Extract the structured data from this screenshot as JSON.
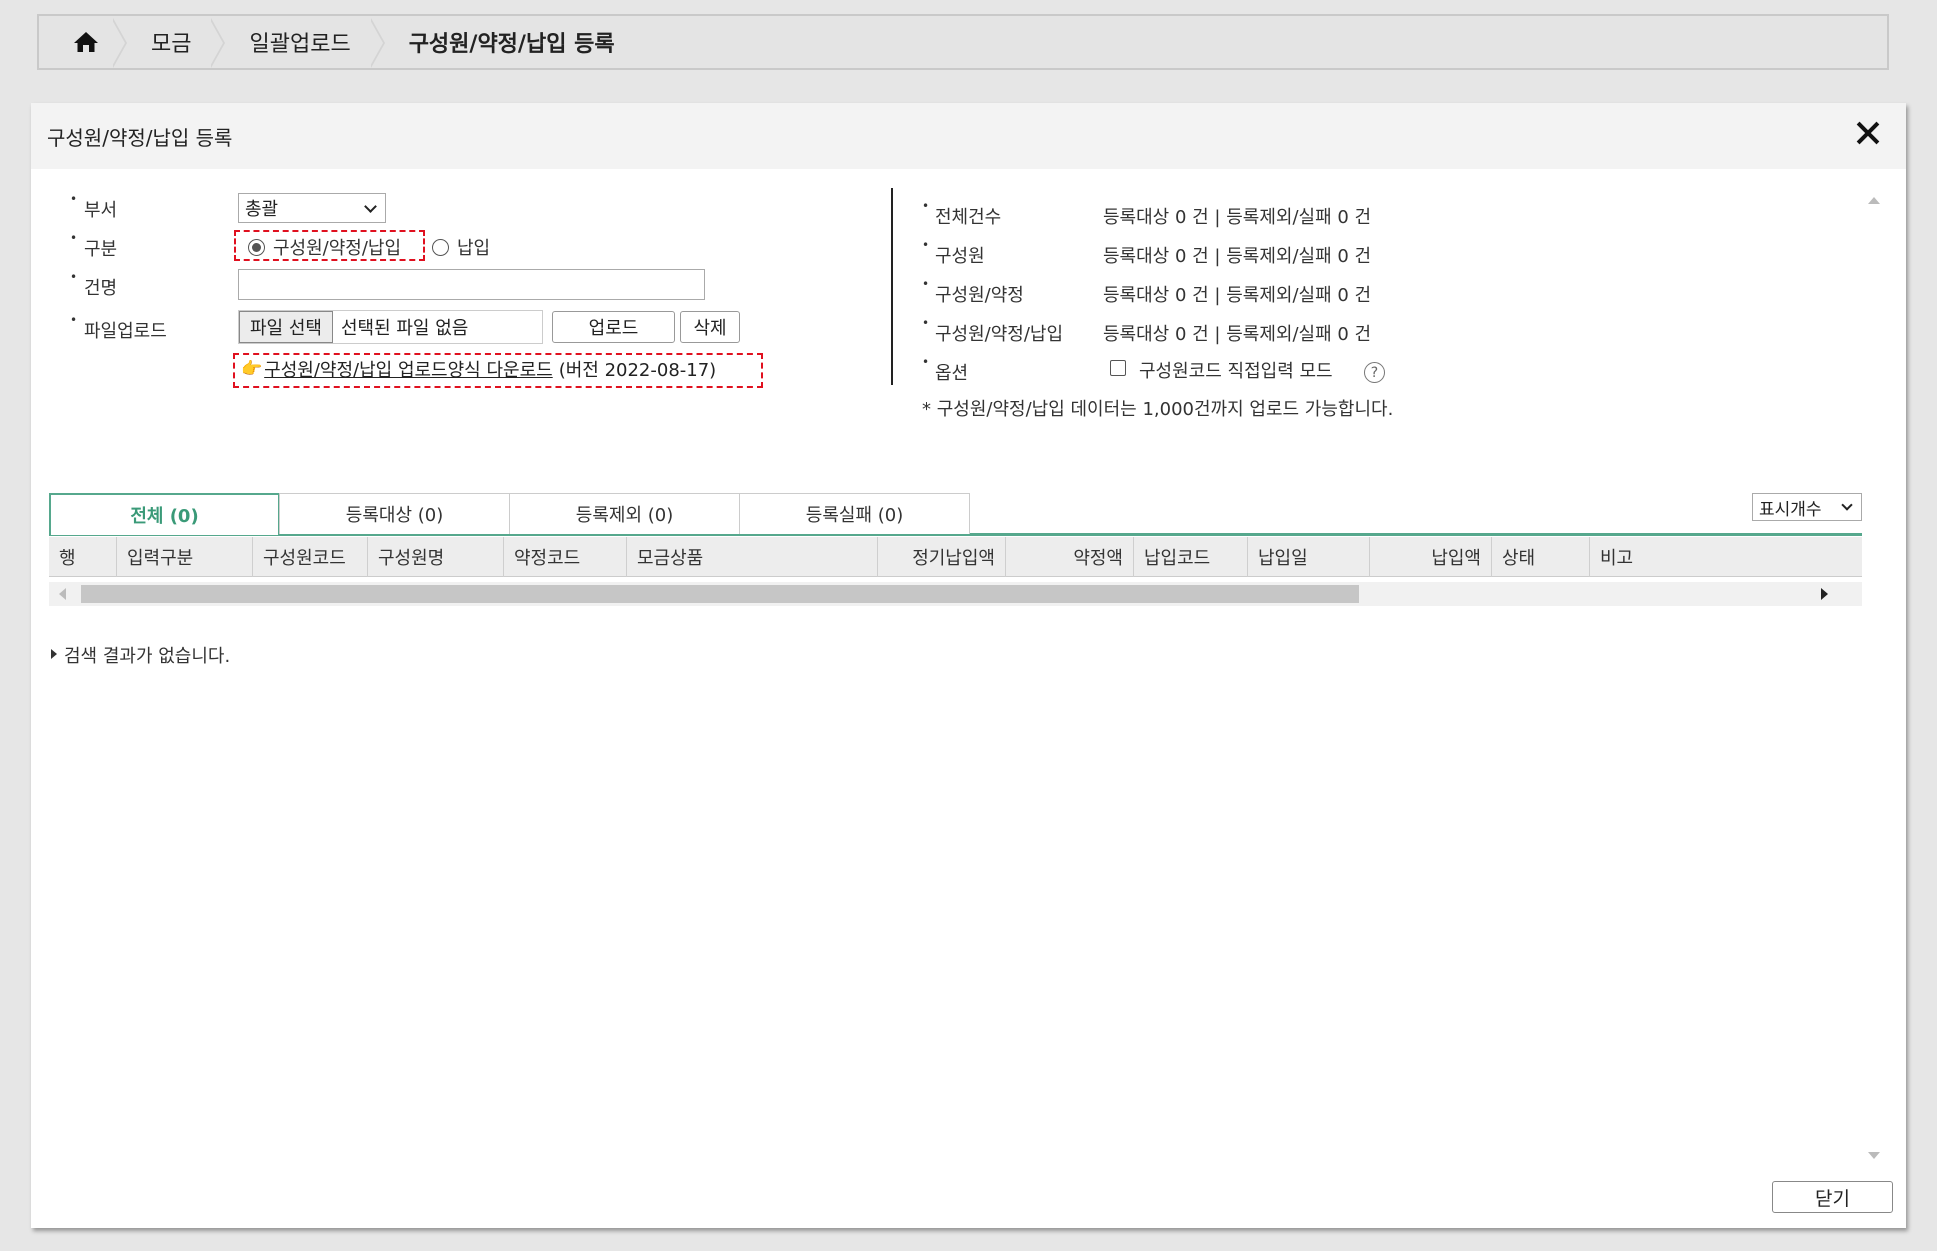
{
  "breadcrumb": {
    "items": [
      "모금",
      "일괄업로드"
    ],
    "current": "구성원/약정/납입 등록"
  },
  "dialog": {
    "title": "구성원/약정/납입 등록",
    "form": {
      "dept_label": "부서",
      "dept_value": "총괄",
      "type_label": "구분",
      "type_options": [
        "구성원/약정/납입",
        "납입"
      ],
      "type_selected": "구성원/약정/납입",
      "name_label": "건명",
      "name_value": "",
      "file_label": "파일업로드",
      "file_button": "파일 선택",
      "file_status": "선택된 파일 없음",
      "upload_button": "업로드",
      "delete_button": "삭제",
      "template_link": "구성원/약정/납입 업로드양식 다운로드",
      "template_version": "(버전 2022-08-17)"
    },
    "stats": {
      "rows": [
        {
          "label": "전체건수",
          "value": "등록대상 0 건 | 등록제외/실패 0 건"
        },
        {
          "label": "구성원",
          "value": "등록대상 0 건 | 등록제외/실패 0 건"
        },
        {
          "label": "구성원/약정",
          "value": "등록대상 0 건 | 등록제외/실패 0 건"
        },
        {
          "label": "구성원/약정/납입",
          "value": "등록대상 0 건 | 등록제외/실패 0 건"
        }
      ],
      "option_label": "옵션",
      "option_checkbox": "구성원코드 직접입력 모드",
      "option_checked": false,
      "help": "?",
      "note": "* 구성원/약정/납입 데이터는 1,000건까지 업로드 가능합니다."
    },
    "tabs": [
      {
        "label": "전체 (0)",
        "active": true
      },
      {
        "label": "등록대상 (0)",
        "active": false
      },
      {
        "label": "등록제외 (0)",
        "active": false
      },
      {
        "label": "등록실패 (0)",
        "active": false
      }
    ],
    "per_page_label": "표시개수",
    "grid_columns": [
      "행",
      "입력구분",
      "구성원코드",
      "구성원명",
      "약정코드",
      "모금상품",
      "정기납입액",
      "약정액",
      "납입코드",
      "납입일",
      "납입액",
      "상태",
      "비고"
    ],
    "empty_message": "검색 결과가 없습니다.",
    "close_button": "닫기"
  },
  "colors": {
    "accent": "#3a9a78",
    "highlight_dash": "#e0101f"
  }
}
